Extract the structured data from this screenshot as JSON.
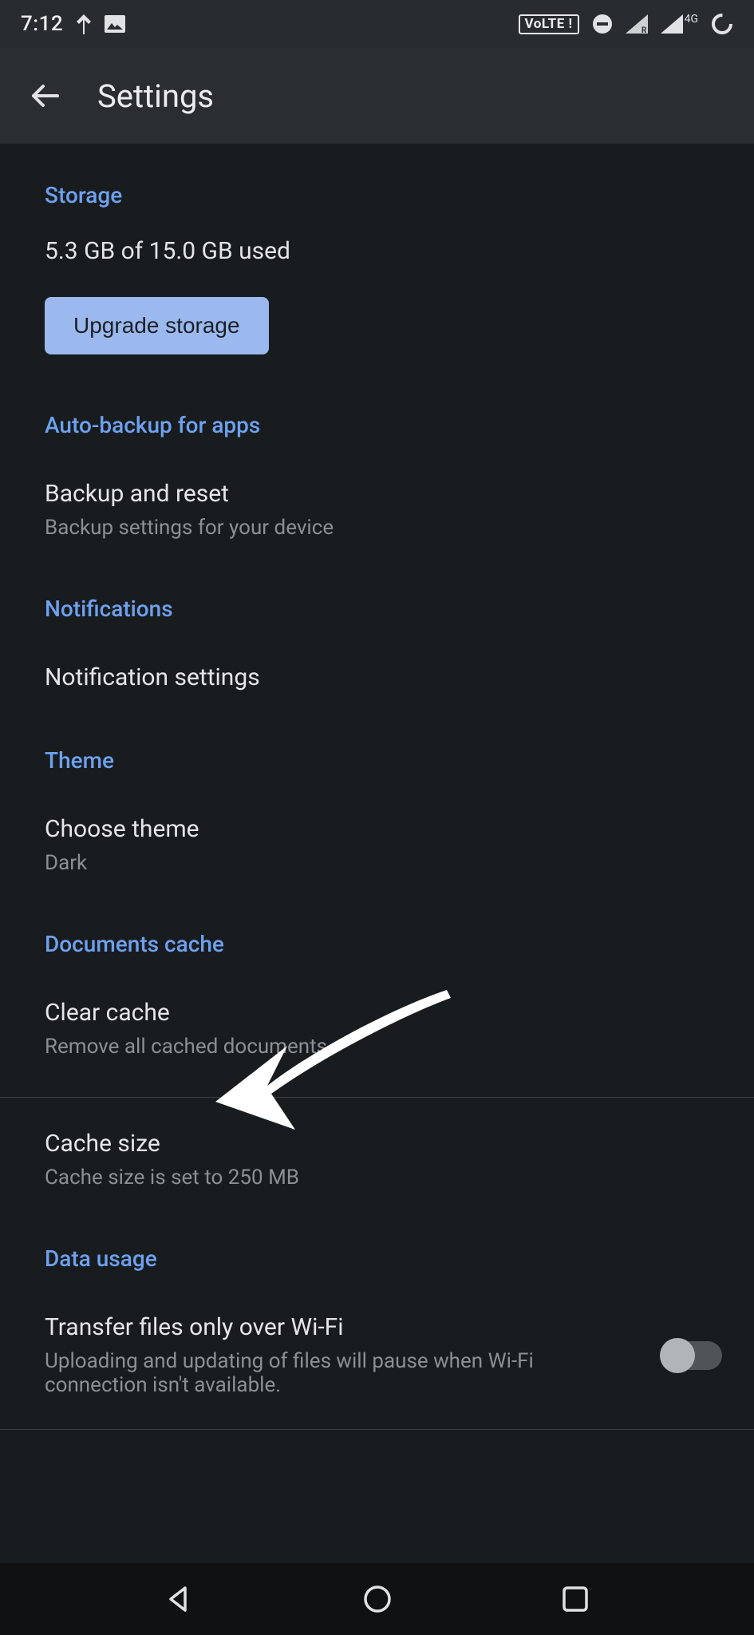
{
  "statusbar": {
    "clock": "7:12",
    "volte": "VoLTE !",
    "network_gen": "4G"
  },
  "appbar": {
    "title": "Settings"
  },
  "storage": {
    "header": "Storage",
    "usage": "5.3 GB of 15.0 GB used",
    "upgrade_button": "Upgrade storage"
  },
  "autobackup": {
    "header": "Auto-backup for apps",
    "item": {
      "title": "Backup and reset",
      "subtitle": "Backup settings for your device"
    }
  },
  "notifications": {
    "header": "Notifications",
    "item": {
      "title": "Notification settings"
    }
  },
  "theme": {
    "header": "Theme",
    "item": {
      "title": "Choose theme",
      "subtitle": "Dark"
    }
  },
  "documents_cache": {
    "header": "Documents cache",
    "clear": {
      "title": "Clear cache",
      "subtitle": "Remove all cached documents"
    },
    "size": {
      "title": "Cache size",
      "subtitle": "Cache size is set to 250 MB"
    }
  },
  "data_usage": {
    "header": "Data usage",
    "wifi_only": {
      "title": "Transfer files only over Wi-Fi",
      "subtitle": "Uploading and updating of files will pause when Wi-Fi connection isn't available."
    }
  }
}
